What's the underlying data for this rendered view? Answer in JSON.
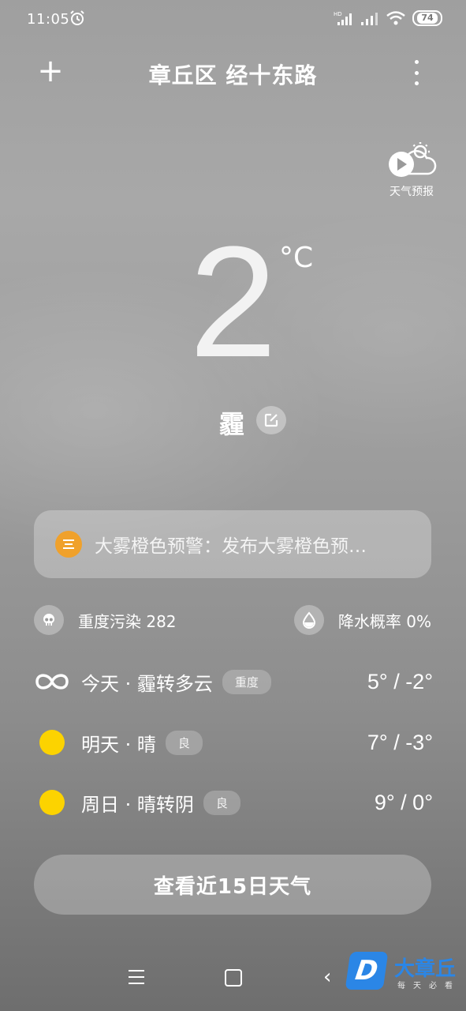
{
  "status_bar": {
    "time": "11:05",
    "battery": "74",
    "icons": [
      "alarm-icon",
      "hd-signal-icon",
      "signal-icon",
      "wifi-icon",
      "battery-icon"
    ]
  },
  "header": {
    "add_symbol": "+",
    "location": "章丘区 经十东路",
    "more_icon": "more-vertical-icon"
  },
  "weather_report": {
    "label": "天气预报",
    "icon": "weather-video-icon"
  },
  "current": {
    "temperature": "2",
    "unit": "°C",
    "condition": "霾",
    "edit_icon": "edit-icon"
  },
  "alert": {
    "text": "大雾橙色预警：发布大雾橙色预…",
    "color": "#f0a12b"
  },
  "aqi": {
    "text": "重度污染 282",
    "icon": "skull-icon"
  },
  "precipitation": {
    "text": "降水概率 0%",
    "icon": "water-drop-icon"
  },
  "forecast": [
    {
      "day": "今天 · 霾转多云",
      "badge": "重度",
      "temp": "5° / -2°",
      "icon": "haze-icon"
    },
    {
      "day": "明天 · 晴",
      "badge": "良",
      "temp": "7° / -3°",
      "icon": "sun-icon"
    },
    {
      "day": "周日 · 晴转阴",
      "badge": "良",
      "temp": "9° / 0°",
      "icon": "sun-icon"
    }
  ],
  "fifteen_day_button": "查看近15日天气",
  "nav_bar": {
    "items": [
      "menu-icon",
      "home-icon",
      "back-icon"
    ],
    "back_symbol": "‹"
  },
  "watermark": {
    "logo_letter": "D",
    "name": "大章丘",
    "slogan": "每天必看",
    "color": "#2b86e6"
  }
}
